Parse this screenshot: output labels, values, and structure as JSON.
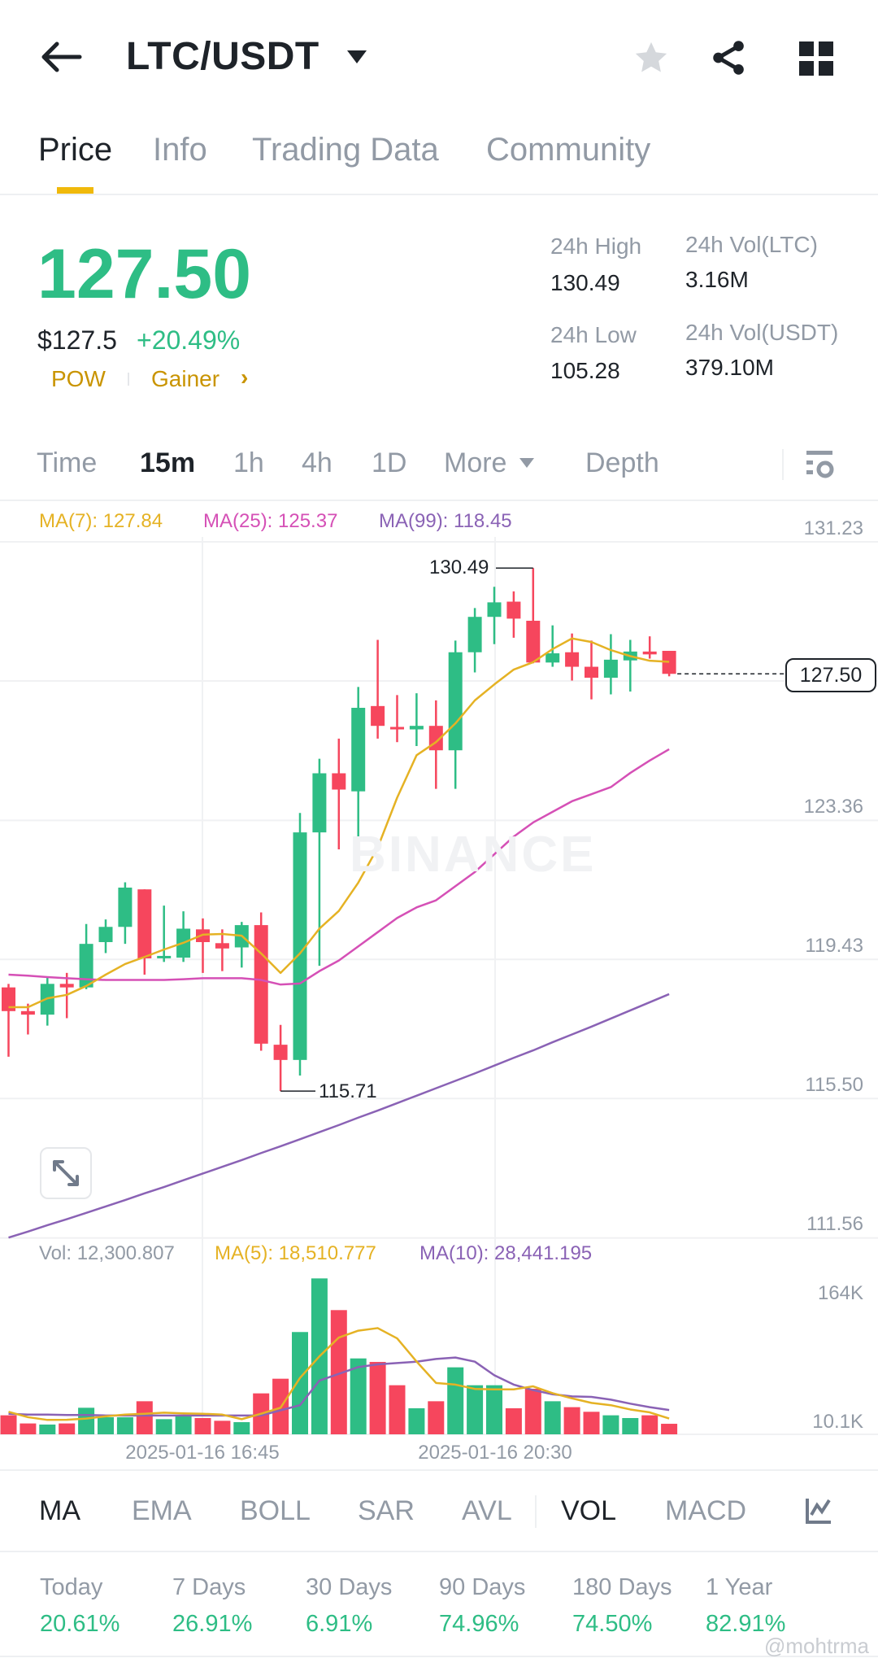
{
  "header": {
    "title": "LTC/USDT",
    "icons": [
      "back-arrow-icon",
      "caret-down-icon",
      "star-icon",
      "share-icon",
      "grid-icon"
    ]
  },
  "tabs": [
    "Price",
    "Info",
    "Trading Data",
    "Community"
  ],
  "ticker": {
    "price": "127.50",
    "usd_price": "$127.5",
    "change": "+20.49%",
    "tags": [
      "POW",
      "Gainer"
    ],
    "high_label": "24h High",
    "high": "130.49",
    "low_label": "24h Low",
    "low": "105.28",
    "vol_ltc_label": "24h Vol(LTC)",
    "vol_ltc": "3.16M",
    "vol_usdt_label": "24h Vol(USDT)",
    "vol_usdt": "379.10M"
  },
  "timeframes": {
    "items": [
      "Time",
      "15m",
      "1h",
      "4h",
      "1D",
      "More",
      "Depth"
    ],
    "selected": "15m"
  },
  "legend": {
    "ma7": "MA(7): 127.84",
    "ma25": "MA(25): 125.37",
    "ma99": "MA(99): 118.45",
    "vol": "Vol: 12,300.807",
    "vma5": "MA(5): 18,510.777",
    "vma10": "MA(10): 28,441.195"
  },
  "watermark": "BINANCE",
  "colors": {
    "up": "#2EBD85",
    "down": "#F6465D",
    "ma7": "#E5B224",
    "ma25": "#D550B6",
    "ma99": "#8A62B5",
    "accent": "#F0B90B"
  },
  "chart_data": {
    "type": "candlestick",
    "price_ticks": [
      "131.23",
      "123.36",
      "119.43",
      "115.50",
      "111.56"
    ],
    "price_ylim": [
      111.56,
      131.23
    ],
    "current_price": "127.50",
    "high_marker": "130.49",
    "low_marker": "115.71",
    "x_ticks": [
      "2025-01-16 16:45",
      "2025-01-16 20:30"
    ],
    "candles_ohlc": [
      [
        118.64,
        118.74,
        116.68,
        117.97
      ],
      [
        117.97,
        118.18,
        117.31,
        117.87
      ],
      [
        117.87,
        118.95,
        117.56,
        118.74
      ],
      [
        118.74,
        119.05,
        117.77,
        118.64
      ],
      [
        118.64,
        120.43,
        118.59,
        119.87
      ],
      [
        119.92,
        120.56,
        119.61,
        120.35
      ],
      [
        120.35,
        121.61,
        119.87,
        121.46
      ],
      [
        121.41,
        121.41,
        119.0,
        119.46
      ],
      [
        119.5,
        120.95,
        119.36,
        119.53
      ],
      [
        119.48,
        120.79,
        119.36,
        120.3
      ],
      [
        120.28,
        120.59,
        119.05,
        119.92
      ],
      [
        119.89,
        120.28,
        119.1,
        119.74
      ],
      [
        119.77,
        120.49,
        119.2,
        120.4
      ],
      [
        120.4,
        120.76,
        116.85,
        117.05
      ],
      [
        117.02,
        117.58,
        115.71,
        116.59
      ],
      [
        116.59,
        123.57,
        116.15,
        123.02
      ],
      [
        123.02,
        125.1,
        119.25,
        124.69
      ],
      [
        124.69,
        125.67,
        122.54,
        124.23
      ],
      [
        124.18,
        127.13,
        122.49,
        126.54
      ],
      [
        126.59,
        128.46,
        125.67,
        126.03
      ],
      [
        126.0,
        126.9,
        125.57,
        125.93
      ],
      [
        125.93,
        126.95,
        125.46,
        126.03
      ],
      [
        126.03,
        126.75,
        124.25,
        125.34
      ],
      [
        125.34,
        128.44,
        124.25,
        128.11
      ],
      [
        128.11,
        129.36,
        127.54,
        129.11
      ],
      [
        129.11,
        129.96,
        128.34,
        129.52
      ],
      [
        129.54,
        129.83,
        128.52,
        129.06
      ],
      [
        129.0,
        130.49,
        127.8,
        127.82
      ],
      [
        127.82,
        128.87,
        127.7,
        128.08
      ],
      [
        128.11,
        128.64,
        127.31,
        127.7
      ],
      [
        127.7,
        128.44,
        126.78,
        127.39
      ],
      [
        127.39,
        128.62,
        126.92,
        127.9
      ],
      [
        127.88,
        128.46,
        127.0,
        128.13
      ],
      [
        128.13,
        128.56,
        127.93,
        128.05
      ],
      [
        128.15,
        128.15,
        127.43,
        127.5
      ]
    ],
    "ma7": [
      118.08,
      118.08,
      118.33,
      118.43,
      118.68,
      119.0,
      119.3,
      119.5,
      119.71,
      119.9,
      120.13,
      120.15,
      120.1,
      119.6,
      119.05,
      119.6,
      120.3,
      120.8,
      121.6,
      122.59,
      124.0,
      125.2,
      125.57,
      126.1,
      126.75,
      127.2,
      127.62,
      127.83,
      128.2,
      128.5,
      128.4,
      128.17,
      128.0,
      127.87,
      127.84
    ],
    "ma25": [
      119.0,
      118.97,
      118.93,
      118.9,
      118.87,
      118.85,
      118.85,
      118.85,
      118.85,
      118.87,
      118.9,
      118.9,
      118.9,
      118.85,
      118.72,
      118.75,
      119.1,
      119.4,
      119.8,
      120.2,
      120.6,
      120.9,
      121.1,
      121.5,
      121.9,
      122.4,
      122.9,
      123.3,
      123.6,
      123.9,
      124.1,
      124.3,
      124.7,
      125.05,
      125.37
    ],
    "ma99": [
      111.57,
      111.74,
      111.92,
      112.09,
      112.27,
      112.45,
      112.63,
      112.82,
      113.0,
      113.19,
      113.38,
      113.57,
      113.76,
      113.96,
      114.15,
      114.35,
      114.55,
      114.75,
      114.96,
      115.16,
      115.37,
      115.58,
      115.79,
      116.0,
      116.21,
      116.43,
      116.65,
      116.86,
      117.09,
      117.31,
      117.53,
      117.76,
      117.99,
      118.22,
      118.45
    ],
    "volume_ticks": [
      "164K",
      "10.1K"
    ],
    "volume_k": [
      22.2,
      12.7,
      11.4,
      12.7,
      31.0,
      19.9,
      19.9,
      38.6,
      17.7,
      22.2,
      19.0,
      15.8,
      14.2,
      47.8,
      64.9,
      119.4,
      182.0,
      145.0,
      88.6,
      84.5,
      57.3,
      30.4,
      38.6,
      78.2,
      57.3,
      57.3,
      30.4,
      53.2,
      38.6,
      31.7,
      26.3,
      22.2,
      19.0,
      22.2,
      12.3
    ],
    "vol_ma5_k": [
      26.3,
      20,
      16.8,
      17,
      18.4,
      21,
      23,
      24,
      25.3,
      24.5,
      24,
      23,
      17.7,
      24,
      31,
      65.8,
      91,
      113,
      121,
      124,
      112,
      85,
      60,
      58,
      53,
      52.5,
      52.5,
      56,
      48,
      42,
      36.7,
      34,
      29,
      25.6,
      18.5
    ],
    "vol_ma10_k": [
      24,
      23,
      23,
      22.5,
      22.5,
      22,
      22,
      22,
      22,
      22,
      22,
      22,
      22,
      22,
      28,
      34,
      62.7,
      70.6,
      78.5,
      81.7,
      83.2,
      84.8,
      88,
      89.6,
      84.8,
      69,
      58,
      51.6,
      46.8,
      44.3,
      43.7,
      40.5,
      35.8,
      31.7,
      28.4
    ]
  },
  "indicators": {
    "items": [
      "MA",
      "EMA",
      "BOLL",
      "SAR",
      "AVL",
      "VOL",
      "MACD"
    ],
    "active": [
      "MA",
      "VOL"
    ]
  },
  "performance": [
    {
      "label": "Today",
      "value": "20.61%"
    },
    {
      "label": "7 Days",
      "value": "26.91%"
    },
    {
      "label": "30 Days",
      "value": "6.91%"
    },
    {
      "label": "90 Days",
      "value": "74.96%"
    },
    {
      "label": "180 Days",
      "value": "74.50%"
    },
    {
      "label": "1 Year",
      "value": "82.91%"
    }
  ],
  "credit": "@mohtrma"
}
